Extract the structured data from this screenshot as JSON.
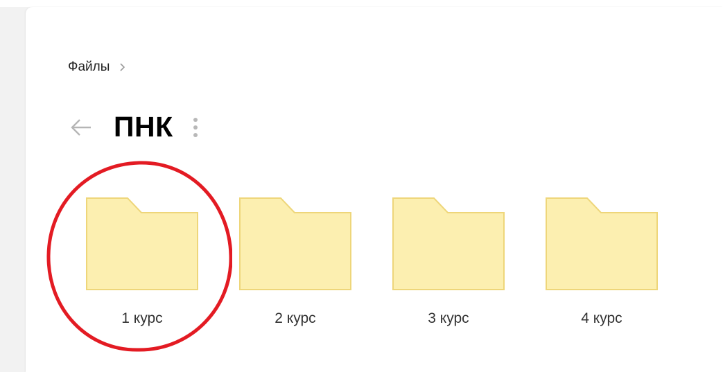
{
  "breadcrumb": {
    "root_label": "Файлы",
    "separator_icon": "chevron-right-icon"
  },
  "header": {
    "back_icon": "arrow-left-icon",
    "title": "ПНК",
    "more_icon": "vertical-dots-icon"
  },
  "folders": [
    {
      "label": "1 курс",
      "highlighted": true
    },
    {
      "label": "2 курс",
      "highlighted": false
    },
    {
      "label": "3 курс",
      "highlighted": false
    },
    {
      "label": "4 курс",
      "highlighted": false
    }
  ],
  "colors": {
    "folder_fill": "#fcefb0",
    "folder_stroke": "#eed67a",
    "highlight_circle": "#e31b23",
    "muted_icon": "#b8b8b8"
  }
}
